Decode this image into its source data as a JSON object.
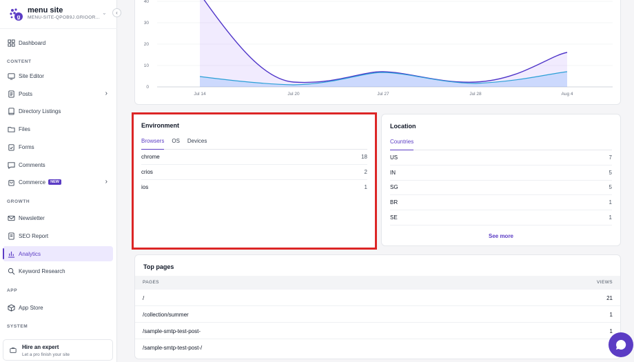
{
  "site": {
    "name": "menu site",
    "domain": "MENU-SITE-QPOB9J.GRIOOR..."
  },
  "sidebar": {
    "dashboard": "Dashboard",
    "sections": {
      "content": "CONTENT",
      "growth": "GROWTH",
      "app": "APP",
      "system": "SYSTEM"
    },
    "items": {
      "site_editor": "Site Editor",
      "posts": "Posts",
      "directory": "Directory Listings",
      "files": "Files",
      "forms": "Forms",
      "comments": "Comments",
      "commerce": "Commerce",
      "commerce_badge": "NEW",
      "newsletter": "Newsletter",
      "seo": "SEO Report",
      "analytics": "Analytics",
      "keyword": "Keyword Research",
      "app_store": "App Store"
    },
    "expert": {
      "title": "Hire an expert",
      "subtitle": "Let a pro finish your site"
    }
  },
  "chart_data": {
    "type": "area",
    "x": [
      "Jul 14",
      "Jul 20",
      "Jul 27",
      "Jul 28",
      "Aug 4"
    ],
    "y_ticks": [
      "40",
      "30",
      "20",
      "10",
      "0"
    ],
    "ylim": [
      0,
      40
    ]
  },
  "environment": {
    "title": "Environment",
    "tabs": [
      "Browsers",
      "OS",
      "Devices"
    ],
    "rows": [
      {
        "label": "chrome",
        "value": "18"
      },
      {
        "label": "crios",
        "value": "2"
      },
      {
        "label": "ios",
        "value": "1"
      }
    ]
  },
  "location": {
    "title": "Location",
    "tabs": [
      "Countries"
    ],
    "rows": [
      {
        "label": "US",
        "value": "7"
      },
      {
        "label": "IN",
        "value": "5"
      },
      {
        "label": "SG",
        "value": "5"
      },
      {
        "label": "BR",
        "value": "1"
      },
      {
        "label": "SE",
        "value": "1"
      }
    ],
    "see_more": "See more"
  },
  "top_pages": {
    "title": "Top pages",
    "col_pages": "PAGES",
    "col_views": "VIEWS",
    "rows": [
      {
        "page": "/",
        "views": "21"
      },
      {
        "page": "/collection/summer",
        "views": "1"
      },
      {
        "page": "/sample-smtp-test-post-",
        "views": "1"
      },
      {
        "page": "/sample-smtp-test-post-/",
        "views": ""
      }
    ]
  },
  "colors": {
    "accent": "#5b3cc4",
    "highlight": "#dc2626"
  }
}
